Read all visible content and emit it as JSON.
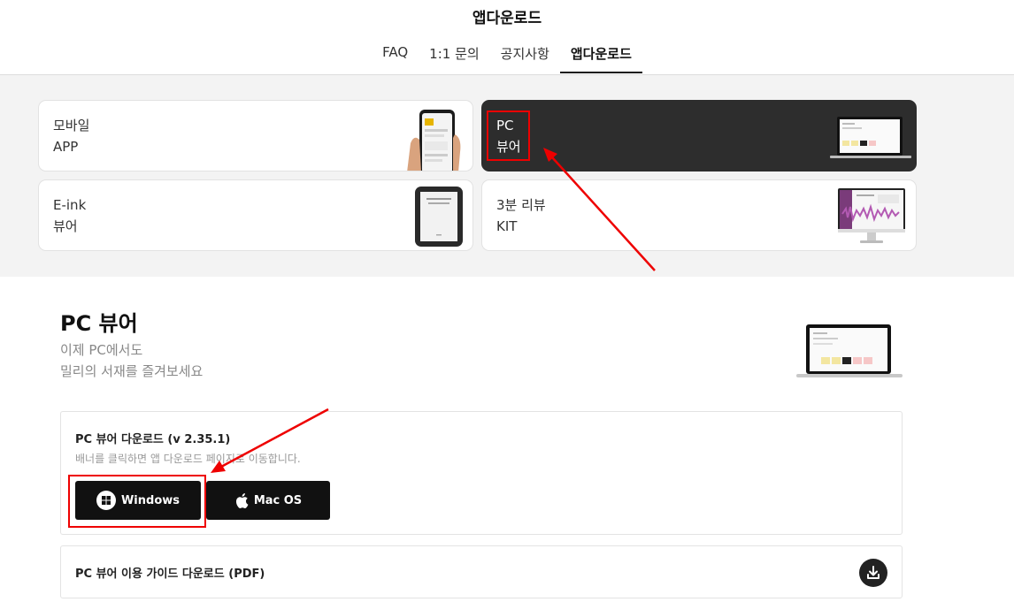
{
  "header": {
    "title": "앱다운로드",
    "tabs": [
      {
        "label": "FAQ"
      },
      {
        "label": "1:1 문의"
      },
      {
        "label": "공지사항"
      },
      {
        "label": "앱다운로드",
        "active": true
      }
    ]
  },
  "cards": [
    {
      "line1": "모바일",
      "line2": "APP",
      "illustration": "phone-illustration"
    },
    {
      "line1": "PC",
      "line2": "뷰어",
      "illustration": "laptop-illustration",
      "selected": true
    },
    {
      "line1": "E-ink",
      "line2": "뷰어",
      "illustration": "ereader-illustration"
    },
    {
      "line1": "3분 리뷰",
      "line2": "KIT",
      "illustration": "monitor-illustration"
    }
  ],
  "viewer": {
    "title": "PC 뷰어",
    "subtitle_line1": "이제 PC에서도",
    "subtitle_line2": "밀리의 서재를 즐겨보세요"
  },
  "download": {
    "title": "PC 뷰어 다운로드 (v 2.35.1)",
    "description": "배너를 클릭하면 앱 다운로드 페이지로 이동합니다.",
    "windows_label": "Windows",
    "mac_label": "Mac OS"
  },
  "guide": {
    "title": "PC 뷰어 이용 가이드 다운로드 (PDF)"
  },
  "colors": {
    "annotation": "#e00000",
    "dark_card": "#2d2d2d",
    "gray_bg": "#f3f3f3"
  }
}
